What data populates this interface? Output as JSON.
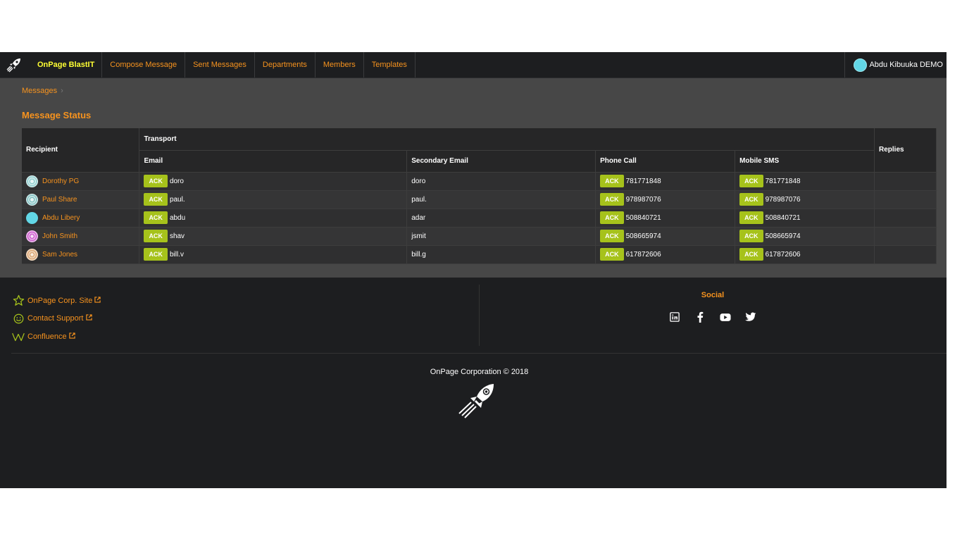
{
  "navbar": {
    "brand": "OnPage BlastIT",
    "items": [
      "Compose Message",
      "Sent Messages",
      "Departments",
      "Members",
      "Templates"
    ],
    "user": "Abdu Kibuuka DEMO"
  },
  "breadcrumb": {
    "item": "Messages",
    "separator": "›"
  },
  "page_title": "Message Status",
  "table": {
    "headers": {
      "recipient": "Recipient",
      "transport": "Transport",
      "replies": "Replies",
      "email": "Email",
      "secondary_email": "Secondary Email",
      "phone_call": "Phone Call",
      "mobile_sms": "Mobile SMS"
    },
    "ack_label": "ACK",
    "rows": [
      {
        "name": "Dorothy PG",
        "email": "doro",
        "secondary": "doro",
        "phone": "781771848",
        "sms": "781771848"
      },
      {
        "name": "Paul Share",
        "email": "paul.",
        "secondary": "paul.",
        "phone": "978987076",
        "sms": "978987076"
      },
      {
        "name": "Abdu Libery",
        "email": "abdu",
        "secondary": "adar",
        "phone": "508840721",
        "sms": "508840721"
      },
      {
        "name": "John Smith",
        "email": "shav",
        "secondary": "jsmit",
        "phone": "508665974",
        "sms": "508665974"
      },
      {
        "name": "Sam Jones",
        "email": "bill.v",
        "secondary": "bill.g",
        "phone": "617872606",
        "sms": "617872606"
      }
    ]
  },
  "footer": {
    "links": [
      "OnPage Corp. Site",
      "Contact Support",
      "Confluence"
    ],
    "social_title": "Social",
    "social_icons": [
      "linkedin-icon",
      "facebook-icon",
      "youtube-icon",
      "twitter-icon"
    ],
    "copyright": "OnPage Corporation © 2018"
  },
  "colors": {
    "accent": "#f7931e",
    "ack": "#a6c21b",
    "brand": "#ffff33"
  }
}
